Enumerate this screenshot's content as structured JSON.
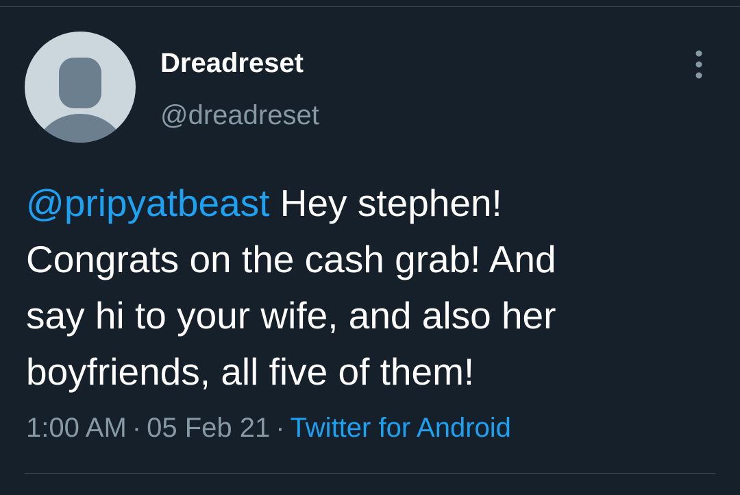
{
  "tweet": {
    "author": {
      "display_name": "Dreadreset",
      "handle": "@dreadreset",
      "avatar_icon": "default-profile-avatar-icon"
    },
    "more_icon": "vertical-ellipsis-icon",
    "text": {
      "mention": "@pripyatbeast",
      "line1_rest": " Hey stephen!",
      "line2": "Congrats on the cash grab! And",
      "line3": "say hi to your wife, and also her",
      "line4": "boyfriends, all five of them!"
    },
    "meta": {
      "time": "1:00 AM",
      "separator": "·",
      "date": "05 Feb 21",
      "source": "Twitter for Android"
    }
  },
  "colors": {
    "background": "#15202b",
    "text_primary": "#ffffff",
    "text_secondary": "#8899a6",
    "accent": "#1da1f2",
    "divider": "#38444d",
    "avatar_bg": "#ccd6dd",
    "avatar_figure": "#6b7f8f"
  }
}
